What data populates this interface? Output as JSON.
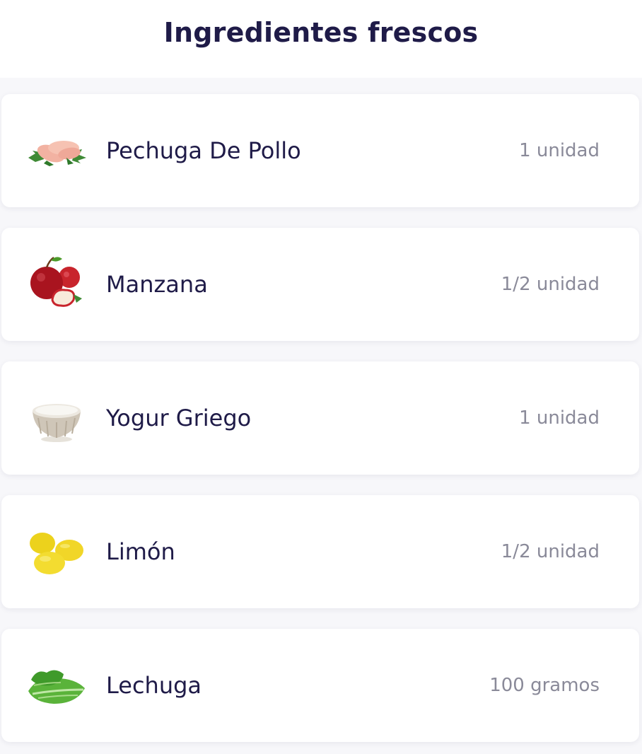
{
  "header": {
    "title": "Ingredientes frescos"
  },
  "ingredients": [
    {
      "name": "Pechuga De Pollo",
      "quantity": "1 unidad",
      "icon": "chicken-breast-icon"
    },
    {
      "name": "Manzana",
      "quantity": "1/2 unidad",
      "icon": "apple-icon"
    },
    {
      "name": "Yogur Griego",
      "quantity": "1 unidad",
      "icon": "yogurt-bowl-icon"
    },
    {
      "name": "Limón",
      "quantity": "1/2 unidad",
      "icon": "lemon-icon"
    },
    {
      "name": "Lechuga",
      "quantity": "100 gramos",
      "icon": "lettuce-icon"
    }
  ],
  "colors": {
    "title": "#1f1b48",
    "name": "#1f1b48",
    "quantity": "#8a8a99",
    "card_background": "#ffffff",
    "page_background": "#f7f7fa"
  }
}
